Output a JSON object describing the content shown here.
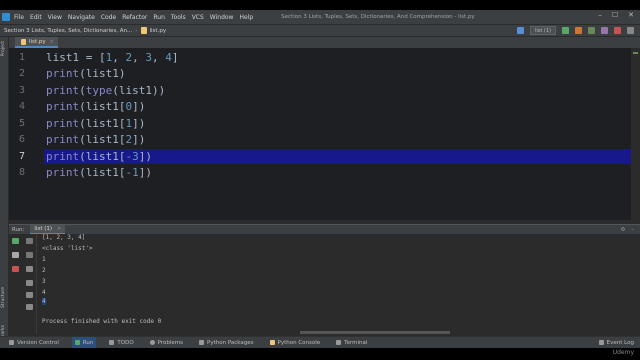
{
  "menubar": {
    "items": [
      "File",
      "Edit",
      "View",
      "Navigate",
      "Code",
      "Refactor",
      "Run",
      "Tools",
      "VCS",
      "Window",
      "Help"
    ],
    "window_title": "Section 3 Lists, Tuples, Sets, Dictionaries, And Comprehension - list.py",
    "controls": [
      "–",
      "☐",
      "✕"
    ]
  },
  "navbar": {
    "project": "Section 3 Lists, Tuples, Sets, Dictionaries, An...",
    "file": "list.py",
    "run_config": "list (1)"
  },
  "left_strip": {
    "project_label": "Project",
    "structure_label": "Structure",
    "bookmarks_label": "Bookmarks"
  },
  "editor": {
    "tab_label": "list.py",
    "tab_close": "×",
    "lines": [
      {
        "n": "1",
        "text": "list1 = [1, 2, 3, 4]"
      },
      {
        "n": "2",
        "text": "print(list1)"
      },
      {
        "n": "3",
        "text": "print(type(list1))"
      },
      {
        "n": "4",
        "text": "print(list1[0])"
      },
      {
        "n": "5",
        "text": "print(list1[1])"
      },
      {
        "n": "6",
        "text": "print(list1[2])"
      },
      {
        "n": "7",
        "text": "print(list1[-3])"
      },
      {
        "n": "8",
        "text": "print(list1[-1])"
      }
    ],
    "highlighted_line": "7",
    "colors": {
      "background": "#1e1f22",
      "highlight": "#17188b",
      "keyword": "#8888c6",
      "number": "#6897bb"
    }
  },
  "run_panel": {
    "label": "Run:",
    "tab": "list (1)",
    "tab_close": "×",
    "header_icons": [
      "⚙",
      "–"
    ],
    "output": [
      "[1, 2, 3, 4]",
      "<class 'list'>",
      "1",
      "2",
      "3",
      "4",
      "4",
      "",
      "Process finished with exit code 0"
    ]
  },
  "statusbar": {
    "items": [
      "Version Control",
      "Run",
      "TODO",
      "Problems",
      "Python Packages",
      "Python Console",
      "Terminal"
    ],
    "active": "Run",
    "event_log": "Event Log"
  },
  "watermark": "Udemy"
}
